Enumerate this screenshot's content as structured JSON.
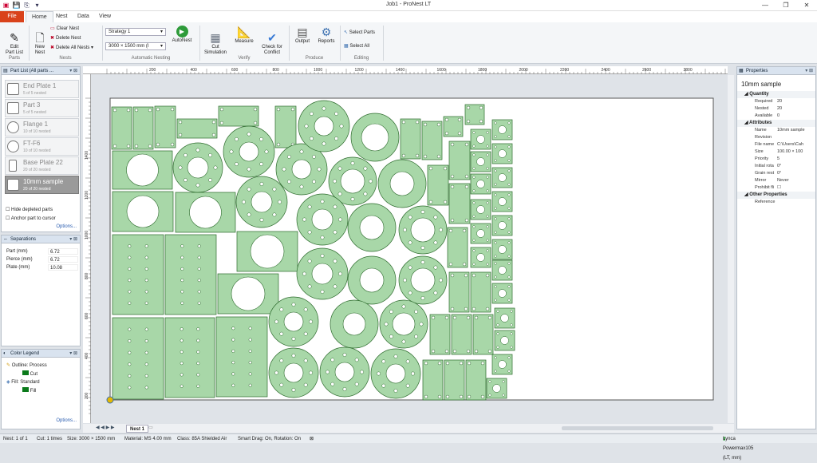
{
  "window": {
    "title": "Job1 - ProNest LT",
    "buttons": [
      "—",
      "❐",
      "✕"
    ]
  },
  "quick_access": [
    "▣",
    "💾",
    "⎘",
    "▾"
  ],
  "tabs": [
    {
      "label": "File"
    },
    {
      "label": "Home"
    },
    {
      "label": "Nest"
    },
    {
      "label": "Data"
    },
    {
      "label": "View"
    }
  ],
  "ribbon": {
    "edit_part_list": "Edit\nPart List",
    "new_nest": "New\nNest",
    "clear_nest": "Clear Nest",
    "delete_nest": "Delete Nest",
    "delete_all_nests": "Delete All Nests",
    "strategy": "Strategy 1",
    "plate_size": "3000 × 1500 mm (I",
    "autonest": "AutoNest",
    "cut_simulation": "Cut\nSimulation",
    "measure": "Measure",
    "check_conflict": "Check for\nConflict",
    "output": "Output",
    "reports": "Reports",
    "select_parts": "Select Parts",
    "select_all": "Select All",
    "groups": [
      "Parts",
      "Nests",
      "Automatic Nesting",
      "Verify",
      "Produce",
      "Editing"
    ]
  },
  "part_list": {
    "title": "Part List  (All parts ...",
    "items": [
      {
        "name": "End Plate 1",
        "status": "5 of 5 nested"
      },
      {
        "name": "Part 3",
        "status": "5 of 5 nested"
      },
      {
        "name": "Flange 1",
        "status": "10 of 10 nested"
      },
      {
        "name": "FT-F6",
        "status": "10 of 10 nested"
      },
      {
        "name": "Base Plate 22",
        "status": "20 of 20 nested"
      },
      {
        "name": "10mm sample",
        "status": "20 of 20 nested"
      }
    ],
    "hide_depleted": "Hide depleted parts",
    "anchor_cursor": "Anchor part to cursor",
    "options": "Options..."
  },
  "separations": {
    "title": "Separations",
    "rows": [
      {
        "label": "Part (mm)",
        "value": "6.72"
      },
      {
        "label": "Pierce (mm)",
        "value": "6.72"
      },
      {
        "label": "Plate (mm)",
        "value": "10.08"
      }
    ]
  },
  "color_legend": {
    "title": "Color Legend",
    "outline": "Outline: Process",
    "cut": "Cut",
    "fill": "Fill: Standard",
    "fill_item": "Fill",
    "options": "Options..."
  },
  "ruler": {
    "top_ticks": [
      "200",
      "400",
      "600",
      "800",
      "1000",
      "1200",
      "1400",
      "1600",
      "1800",
      "2000",
      "2200",
      "2400",
      "2600",
      "2800"
    ],
    "left_ticks": [
      "1400",
      "1200",
      "1000",
      "800",
      "600",
      "400",
      "200"
    ]
  },
  "nest_tab": "Nest 1",
  "properties": {
    "title": "Properties",
    "header": "10mm sample",
    "sections": [
      {
        "name": "Quantity",
        "rows": [
          {
            "k": "Required",
            "v": "20"
          },
          {
            "k": "Nested",
            "v": "20"
          },
          {
            "k": "Available",
            "v": "0"
          }
        ]
      },
      {
        "name": "Attributes",
        "rows": [
          {
            "k": "Name",
            "v": "10mm sample"
          },
          {
            "k": "Revision",
            "v": ""
          },
          {
            "k": "File name",
            "v": "C:\\Users\\Cah"
          },
          {
            "k": "Size",
            "v": "100.00 × 100"
          },
          {
            "k": "Priority",
            "v": "5"
          },
          {
            "k": "Initial rota",
            "v": "0°"
          },
          {
            "k": "Grain rest",
            "v": "0°"
          },
          {
            "k": "Mirror",
            "v": "Never"
          },
          {
            "k": "Prohibit fli",
            "v": ""
          }
        ]
      },
      {
        "name": "Other Properties",
        "rows": [
          {
            "k": "Reference",
            "v": ""
          }
        ]
      }
    ]
  },
  "status": {
    "nest": "Nest: 1 of 1",
    "cut": "Cut: 1 times",
    "size": "Size: 3000 × 1500 mm",
    "material": "Material: MS 4.00 mm",
    "class": "Class: 85A Shielded Air",
    "smart_drag": "Smart Drag: On, Rotation: On",
    "machine": "Lynca Powermax105 (LT, mm)"
  },
  "colors": {
    "part_fill": "#a8d7a8",
    "part_stroke": "#2d6b2d",
    "file_tab": "#d9421b",
    "selected": "#9a9a9a"
  }
}
